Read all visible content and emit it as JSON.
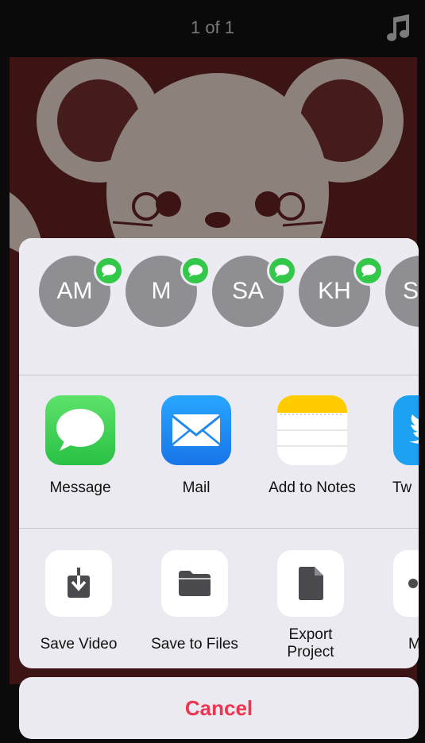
{
  "header": {
    "title": "1 of 1",
    "music_icon": "music-note-icon"
  },
  "share_sheet": {
    "people": [
      {
        "initials": "AM",
        "badge_icon": "message-bubble-icon"
      },
      {
        "initials": "M",
        "badge_icon": "message-bubble-icon"
      },
      {
        "initials": "SA",
        "badge_icon": "message-bubble-icon"
      },
      {
        "initials": "KH",
        "badge_icon": "message-bubble-icon"
      },
      {
        "initials": "S",
        "badge_icon": "message-bubble-icon"
      }
    ],
    "apps": [
      {
        "label": "Message",
        "icon": "messages-app-icon",
        "color": "#34c759"
      },
      {
        "label": "Mail",
        "icon": "mail-app-icon",
        "color": "#1e88f5"
      },
      {
        "label": "Add to Notes",
        "icon": "notes-app-icon",
        "color": "#ffcc00"
      },
      {
        "label": "Tw",
        "icon": "twitter-app-icon",
        "color": "#1da1f2"
      }
    ],
    "actions": [
      {
        "label": "Save Video",
        "icon": "save-video-icon"
      },
      {
        "label": "Save to Files",
        "icon": "folder-icon"
      },
      {
        "label": "Export Project",
        "icon": "document-icon"
      },
      {
        "label": "M",
        "icon": "more-icon"
      }
    ]
  },
  "cancel": {
    "label": "Cancel",
    "color": "#f0334f"
  }
}
